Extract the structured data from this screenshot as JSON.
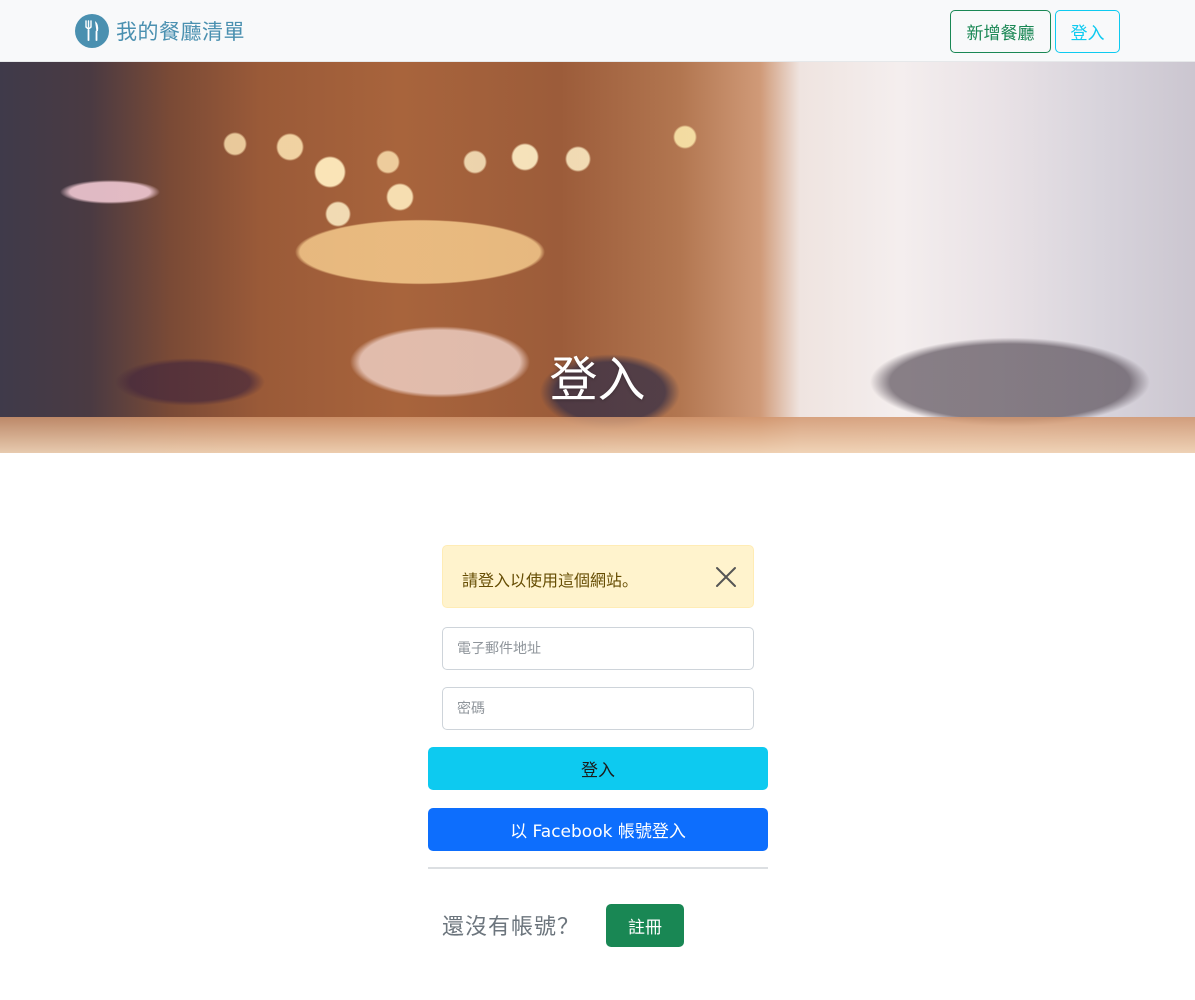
{
  "navbar": {
    "brand": "我的餐廳清單",
    "brand_icon": "utensils-icon",
    "add_restaurant_label": "新增餐廳",
    "login_label": "登入"
  },
  "banner": {
    "title": "登入"
  },
  "alert": {
    "message": "請登入以使用這個網站。",
    "close_icon": "close-icon"
  },
  "form": {
    "email_placeholder": "電子郵件地址",
    "password_placeholder": "密碼",
    "login_button": "登入",
    "facebook_button": "以 Facebook 帳號登入"
  },
  "register": {
    "prompt": "還沒有帳號？",
    "button": "註冊"
  },
  "colors": {
    "brand": "#4a90b0",
    "success": "#198754",
    "info": "#0dcaf0",
    "primary": "#0d6efd",
    "warning_bg": "#fff3cd"
  }
}
